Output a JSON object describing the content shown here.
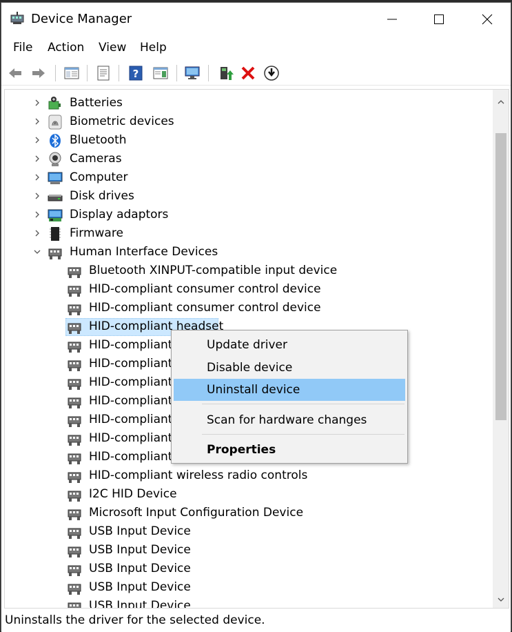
{
  "window": {
    "title": "Device Manager"
  },
  "menubar": {
    "items": [
      "File",
      "Action",
      "View",
      "Help"
    ]
  },
  "tree": {
    "categories": [
      {
        "label": "Batteries",
        "icon": "battery-icon"
      },
      {
        "label": "Biometric devices",
        "icon": "fingerprint-icon"
      },
      {
        "label": "Bluetooth",
        "icon": "bluetooth-icon"
      },
      {
        "label": "Cameras",
        "icon": "camera-icon"
      },
      {
        "label": "Computer",
        "icon": "monitor-icon"
      },
      {
        "label": "Disk drives",
        "icon": "disk-drive-icon"
      },
      {
        "label": "Display adaptors",
        "icon": "display-adapter-icon"
      },
      {
        "label": "Firmware",
        "icon": "firmware-chip-icon"
      },
      {
        "label": "Human Interface Devices",
        "icon": "hid-icon",
        "expanded": true
      }
    ],
    "hid_children": [
      "Bluetooth XINPUT-compatible input device",
      "HID-compliant consumer control device",
      "HID-compliant consumer control device",
      "HID-compliant headset",
      "HID-compliant",
      "HID-compliant",
      "HID-compliant",
      "HID-compliant",
      "HID-compliant",
      "HID-compliant",
      "HID-compliant",
      "HID-compliant wireless radio controls",
      "I2C HID Device",
      "Microsoft Input Configuration Device",
      "USB Input Device",
      "USB Input Device",
      "USB Input Device",
      "USB Input Device",
      "USB Input Device"
    ],
    "selected_index": 3
  },
  "context_menu": {
    "update": "Update driver",
    "disable": "Disable device",
    "uninstall": "Uninstall device",
    "scan": "Scan for hardware changes",
    "properties": "Properties"
  },
  "statusbar": {
    "text": "Uninstalls the driver for the selected device."
  },
  "colors": {
    "selection": "#cce8ff",
    "menu_highlight": "#91c9f7"
  }
}
